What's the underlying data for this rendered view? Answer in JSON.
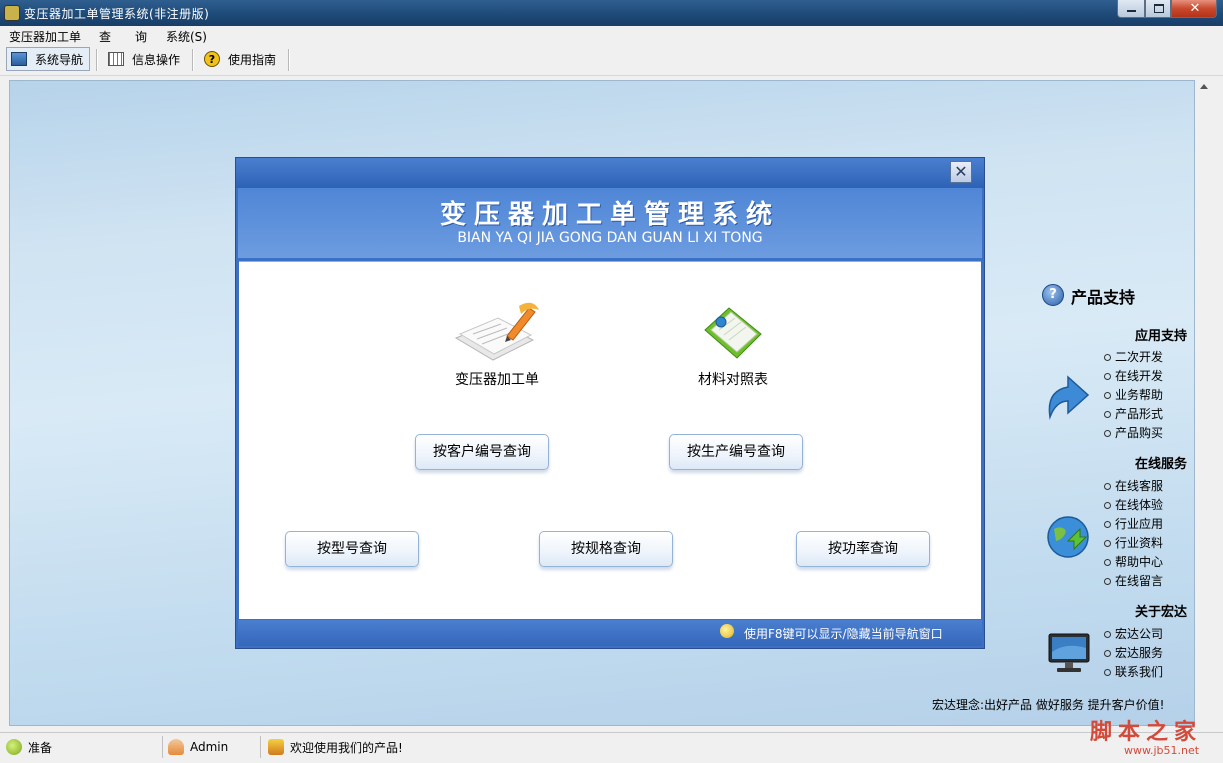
{
  "window": {
    "title": "变压器加工单管理系统(非注册版)",
    "close_glyph": "✕"
  },
  "menubar": {
    "items": [
      "变压器加工单",
      "查　　询",
      "系统(S)"
    ]
  },
  "toolbar": {
    "nav": "系统导航",
    "info": "信息操作",
    "guide": "使用指南",
    "guide_icon_glyph": "?"
  },
  "dialog": {
    "close_glyph": "✕",
    "title": "变压器加工单管理系统",
    "subtitle": "BIAN YA QI JIA GONG DAN GUAN LI XI TONG",
    "icons": [
      {
        "label": "变压器加工单",
        "icon": "document-pen-icon"
      },
      {
        "label": "材料对照表",
        "icon": "notebook-icon"
      }
    ],
    "buttons": [
      "按客户编号查询",
      "按生产编号查询",
      "按型号查询",
      "按规格查询",
      "按功率查询"
    ],
    "footer": "使用F8键可以显示/隐藏当前导航窗口"
  },
  "support": {
    "icon_glyph": "?",
    "title": "产品支持",
    "sections": [
      {
        "title": "应用支持",
        "links": [
          "二次开发",
          "在线开发",
          "业务帮助",
          "产品形式",
          "产品购买"
        ]
      },
      {
        "title": "在线服务",
        "links": [
          "在线客服",
          "在线体验",
          "行业应用",
          "行业资料",
          "帮助中心",
          "在线留言"
        ]
      },
      {
        "title": "关于宏达",
        "links": [
          "宏达公司",
          "宏达服务",
          "联系我们"
        ]
      }
    ],
    "motto": "宏达理念:出好产品 做好服务 提升客户价值!"
  },
  "statusbar": {
    "ready": "准备",
    "user": "Admin",
    "welcome": "欢迎使用我们的产品!"
  },
  "watermark": {
    "cn": "脚本之家",
    "url": "www.jb51.net"
  }
}
